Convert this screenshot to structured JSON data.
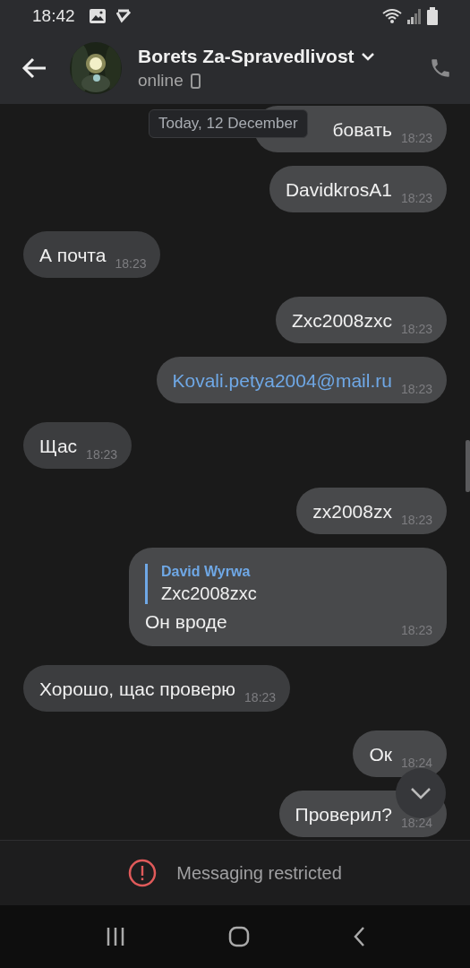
{
  "status_bar": {
    "time": "18:42"
  },
  "header": {
    "title": "Borets Za-Spravedlivost",
    "status": "online"
  },
  "date_badge": "Today, 12 December",
  "messages": [
    {
      "outgoing": true,
      "kind": "text",
      "text": "бовать",
      "time": "18:23"
    },
    {
      "outgoing": true,
      "kind": "text",
      "text": "DavidkrosA1",
      "time": "18:23"
    },
    {
      "outgoing": false,
      "kind": "text",
      "text": "А почта",
      "time": "18:23"
    },
    {
      "outgoing": true,
      "kind": "text",
      "text": "Zxc2008zxc",
      "time": "18:23"
    },
    {
      "outgoing": true,
      "kind": "link",
      "text": "Kovali.petya2004@mail.ru",
      "time": "18:23"
    },
    {
      "outgoing": false,
      "kind": "text",
      "text": "Щас",
      "time": "18:23"
    },
    {
      "outgoing": true,
      "kind": "text",
      "text": "zx2008zx",
      "time": "18:23"
    },
    {
      "outgoing": true,
      "kind": "reply",
      "reply": {
        "author": "David Wyrwa",
        "text": "Zxc2008zxc"
      },
      "text": "Он вроде",
      "time": "18:23"
    },
    {
      "outgoing": false,
      "kind": "text",
      "text": "Хорошо, щас проверю",
      "time": "18:23"
    },
    {
      "outgoing": true,
      "kind": "text",
      "text": "Ок",
      "time": "18:24"
    },
    {
      "outgoing": true,
      "kind": "text",
      "text": "Проверил?",
      "time": "18:24"
    }
  ],
  "footer": {
    "notice": "Messaging restricted"
  }
}
